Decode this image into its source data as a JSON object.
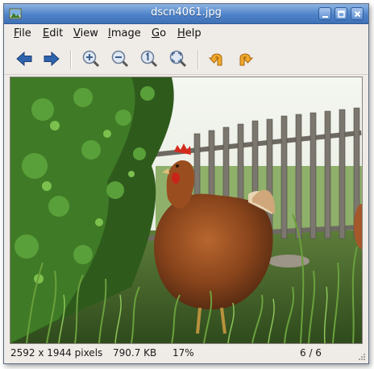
{
  "window": {
    "title": "dscn4061.jpg",
    "app_icon": "image-viewer-icon",
    "controls": [
      "minimize-icon",
      "maximize-icon",
      "close-icon"
    ]
  },
  "menubar": {
    "items": [
      {
        "label": "File",
        "mnemonic": "F",
        "rest": "ile"
      },
      {
        "label": "Edit",
        "mnemonic": "E",
        "rest": "dit"
      },
      {
        "label": "View",
        "mnemonic": "V",
        "rest": "iew"
      },
      {
        "label": "Image",
        "mnemonic": "I",
        "rest": "mage"
      },
      {
        "label": "Go",
        "mnemonic": "G",
        "rest": "o"
      },
      {
        "label": "Help",
        "mnemonic": "H",
        "rest": "elp"
      }
    ]
  },
  "toolbar": {
    "buttons": [
      "back-arrow-icon",
      "forward-arrow-icon",
      "zoom-in-icon",
      "zoom-out-icon",
      "zoom-100-icon",
      "zoom-fit-icon",
      "rotate-left-icon",
      "rotate-right-icon"
    ]
  },
  "colors": {
    "titlebar_top": "#8eb4e3",
    "titlebar_bottom": "#3f70b6",
    "nav_arrow": "#2b5ea8",
    "rotate_arrow": "#e8a020",
    "window_bg": "#efebe7"
  },
  "image": {
    "description_subject": "photo"
  },
  "status": {
    "dimensions": "2592 x 1944 pixels",
    "filesize": "790.7 KB",
    "zoom": "17%",
    "position": "6 / 6"
  }
}
